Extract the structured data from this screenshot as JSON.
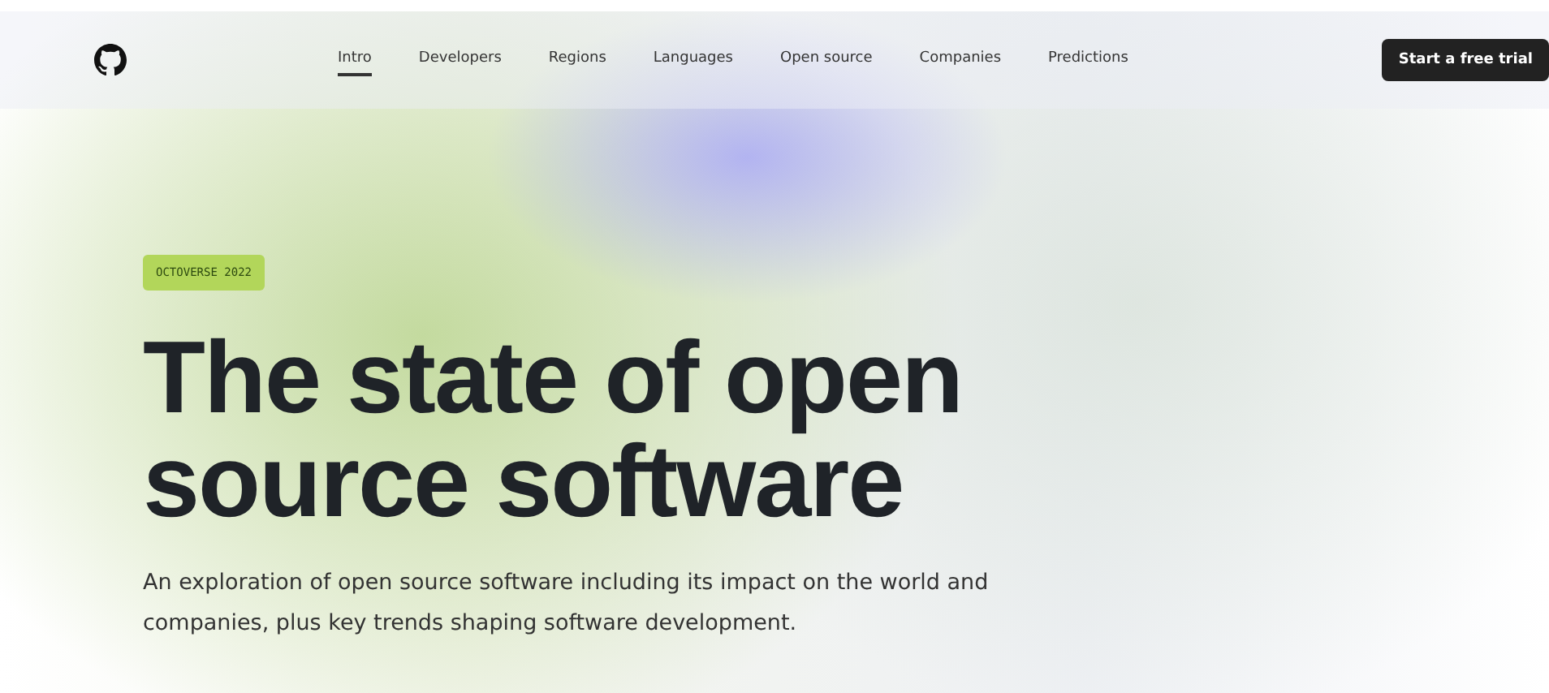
{
  "nav": {
    "items": [
      {
        "label": "Intro",
        "selected": true
      },
      {
        "label": "Developers",
        "selected": false
      },
      {
        "label": "Regions",
        "selected": false
      },
      {
        "label": "Languages",
        "selected": false
      },
      {
        "label": "Open source",
        "selected": false
      },
      {
        "label": "Companies",
        "selected": false
      },
      {
        "label": "Predictions",
        "selected": false
      }
    ],
    "cta": "Start a free trial"
  },
  "hero": {
    "badge": "OCTOVERSE 2022",
    "title": "The state of open source software",
    "description": "An exploration of open source software including its impact on the world and companies, plus key trends shaping software development."
  }
}
